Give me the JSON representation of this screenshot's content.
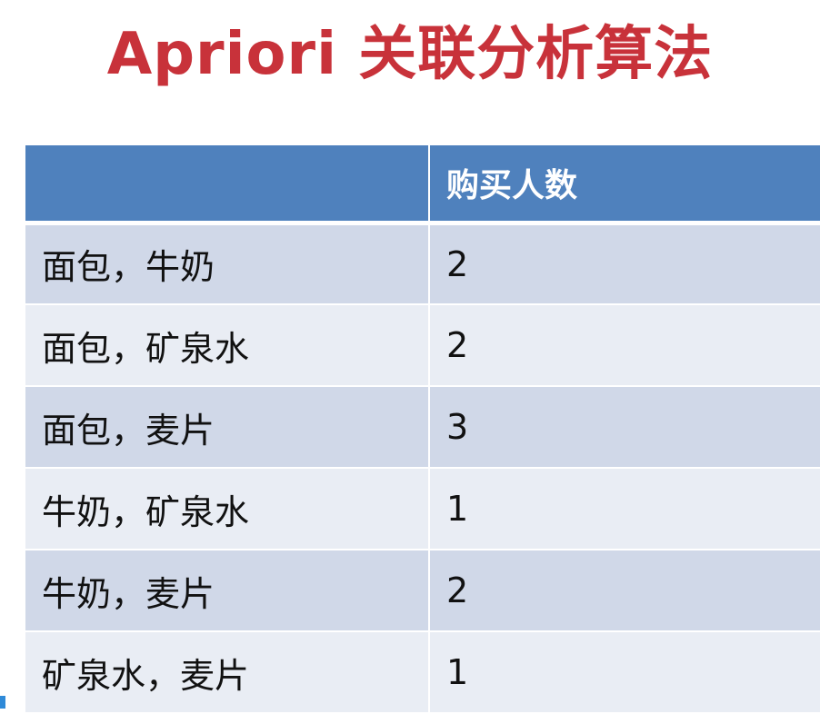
{
  "slide": {
    "title": "Apriori 关联分析算法"
  },
  "table": {
    "headers": [
      "",
      "购买人数"
    ],
    "rows": [
      {
        "items": "面包，牛奶",
        "count": "2"
      },
      {
        "items": "面包，矿泉水",
        "count": "2"
      },
      {
        "items": "面包，麦片",
        "count": "3"
      },
      {
        "items": "牛奶，矿泉水",
        "count": "1"
      },
      {
        "items": "牛奶，麦片",
        "count": "2"
      },
      {
        "items": "矿泉水，麦片",
        "count": "1"
      }
    ]
  },
  "colors": {
    "title": "#c8323a",
    "header_bg": "#4f81bd",
    "row_odd_bg": "#d0d8e8",
    "row_even_bg": "#e9edf4"
  }
}
